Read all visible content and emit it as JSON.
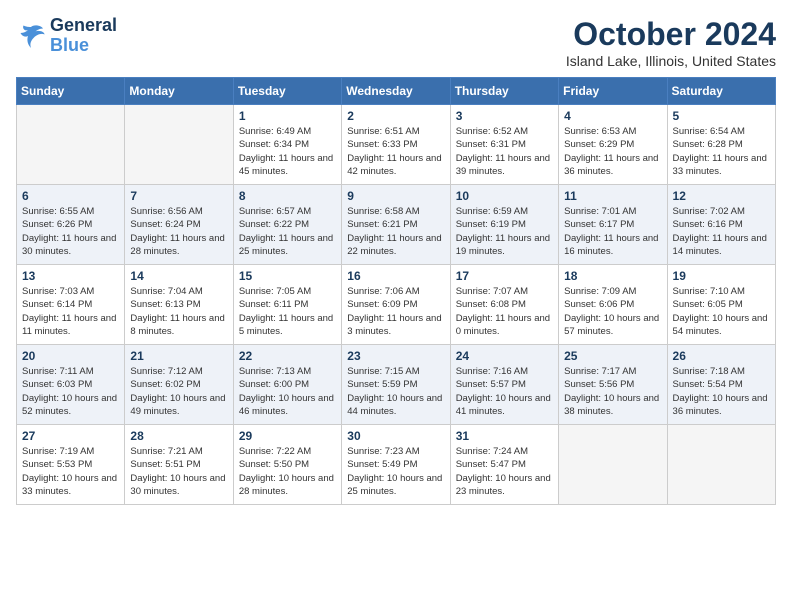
{
  "logo": {
    "text_general": "General",
    "text_blue": "Blue"
  },
  "title": "October 2024",
  "location": "Island Lake, Illinois, United States",
  "days_of_week": [
    "Sunday",
    "Monday",
    "Tuesday",
    "Wednesday",
    "Thursday",
    "Friday",
    "Saturday"
  ],
  "weeks": [
    {
      "alt": false,
      "days": [
        {
          "number": "",
          "info": ""
        },
        {
          "number": "",
          "info": ""
        },
        {
          "number": "1",
          "info": "Sunrise: 6:49 AM\nSunset: 6:34 PM\nDaylight: 11 hours and 45 minutes."
        },
        {
          "number": "2",
          "info": "Sunrise: 6:51 AM\nSunset: 6:33 PM\nDaylight: 11 hours and 42 minutes."
        },
        {
          "number": "3",
          "info": "Sunrise: 6:52 AM\nSunset: 6:31 PM\nDaylight: 11 hours and 39 minutes."
        },
        {
          "number": "4",
          "info": "Sunrise: 6:53 AM\nSunset: 6:29 PM\nDaylight: 11 hours and 36 minutes."
        },
        {
          "number": "5",
          "info": "Sunrise: 6:54 AM\nSunset: 6:28 PM\nDaylight: 11 hours and 33 minutes."
        }
      ]
    },
    {
      "alt": true,
      "days": [
        {
          "number": "6",
          "info": "Sunrise: 6:55 AM\nSunset: 6:26 PM\nDaylight: 11 hours and 30 minutes."
        },
        {
          "number": "7",
          "info": "Sunrise: 6:56 AM\nSunset: 6:24 PM\nDaylight: 11 hours and 28 minutes."
        },
        {
          "number": "8",
          "info": "Sunrise: 6:57 AM\nSunset: 6:22 PM\nDaylight: 11 hours and 25 minutes."
        },
        {
          "number": "9",
          "info": "Sunrise: 6:58 AM\nSunset: 6:21 PM\nDaylight: 11 hours and 22 minutes."
        },
        {
          "number": "10",
          "info": "Sunrise: 6:59 AM\nSunset: 6:19 PM\nDaylight: 11 hours and 19 minutes."
        },
        {
          "number": "11",
          "info": "Sunrise: 7:01 AM\nSunset: 6:17 PM\nDaylight: 11 hours and 16 minutes."
        },
        {
          "number": "12",
          "info": "Sunrise: 7:02 AM\nSunset: 6:16 PM\nDaylight: 11 hours and 14 minutes."
        }
      ]
    },
    {
      "alt": false,
      "days": [
        {
          "number": "13",
          "info": "Sunrise: 7:03 AM\nSunset: 6:14 PM\nDaylight: 11 hours and 11 minutes."
        },
        {
          "number": "14",
          "info": "Sunrise: 7:04 AM\nSunset: 6:13 PM\nDaylight: 11 hours and 8 minutes."
        },
        {
          "number": "15",
          "info": "Sunrise: 7:05 AM\nSunset: 6:11 PM\nDaylight: 11 hours and 5 minutes."
        },
        {
          "number": "16",
          "info": "Sunrise: 7:06 AM\nSunset: 6:09 PM\nDaylight: 11 hours and 3 minutes."
        },
        {
          "number": "17",
          "info": "Sunrise: 7:07 AM\nSunset: 6:08 PM\nDaylight: 11 hours and 0 minutes."
        },
        {
          "number": "18",
          "info": "Sunrise: 7:09 AM\nSunset: 6:06 PM\nDaylight: 10 hours and 57 minutes."
        },
        {
          "number": "19",
          "info": "Sunrise: 7:10 AM\nSunset: 6:05 PM\nDaylight: 10 hours and 54 minutes."
        }
      ]
    },
    {
      "alt": true,
      "days": [
        {
          "number": "20",
          "info": "Sunrise: 7:11 AM\nSunset: 6:03 PM\nDaylight: 10 hours and 52 minutes."
        },
        {
          "number": "21",
          "info": "Sunrise: 7:12 AM\nSunset: 6:02 PM\nDaylight: 10 hours and 49 minutes."
        },
        {
          "number": "22",
          "info": "Sunrise: 7:13 AM\nSunset: 6:00 PM\nDaylight: 10 hours and 46 minutes."
        },
        {
          "number": "23",
          "info": "Sunrise: 7:15 AM\nSunset: 5:59 PM\nDaylight: 10 hours and 44 minutes."
        },
        {
          "number": "24",
          "info": "Sunrise: 7:16 AM\nSunset: 5:57 PM\nDaylight: 10 hours and 41 minutes."
        },
        {
          "number": "25",
          "info": "Sunrise: 7:17 AM\nSunset: 5:56 PM\nDaylight: 10 hours and 38 minutes."
        },
        {
          "number": "26",
          "info": "Sunrise: 7:18 AM\nSunset: 5:54 PM\nDaylight: 10 hours and 36 minutes."
        }
      ]
    },
    {
      "alt": false,
      "days": [
        {
          "number": "27",
          "info": "Sunrise: 7:19 AM\nSunset: 5:53 PM\nDaylight: 10 hours and 33 minutes."
        },
        {
          "number": "28",
          "info": "Sunrise: 7:21 AM\nSunset: 5:51 PM\nDaylight: 10 hours and 30 minutes."
        },
        {
          "number": "29",
          "info": "Sunrise: 7:22 AM\nSunset: 5:50 PM\nDaylight: 10 hours and 28 minutes."
        },
        {
          "number": "30",
          "info": "Sunrise: 7:23 AM\nSunset: 5:49 PM\nDaylight: 10 hours and 25 minutes."
        },
        {
          "number": "31",
          "info": "Sunrise: 7:24 AM\nSunset: 5:47 PM\nDaylight: 10 hours and 23 minutes."
        },
        {
          "number": "",
          "info": ""
        },
        {
          "number": "",
          "info": ""
        }
      ]
    }
  ]
}
